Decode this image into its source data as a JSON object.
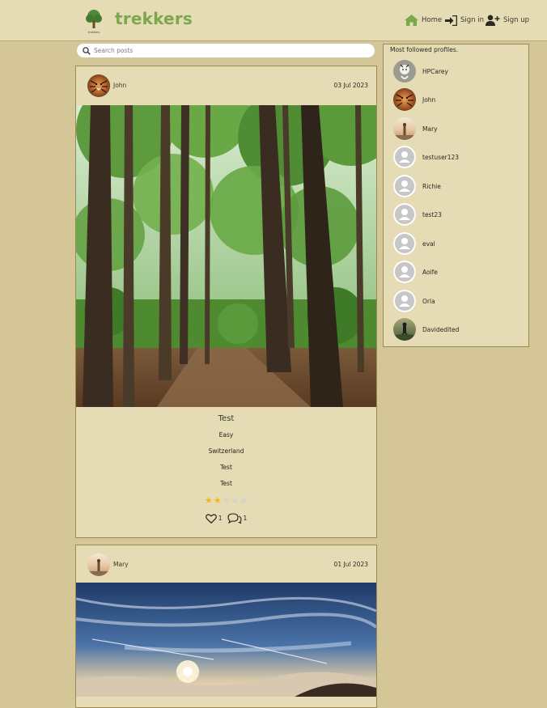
{
  "nav": {
    "brand": "trekkers",
    "logo_caption": "trekkers",
    "links": [
      {
        "label": "Home",
        "icon": "home-icon"
      },
      {
        "label": "Sign in",
        "icon": "sign-in-icon"
      },
      {
        "label": "Sign up",
        "icon": "add-user-icon"
      }
    ],
    "accent_color": "#7ba84a"
  },
  "search": {
    "placeholder": "Search posts",
    "value": ""
  },
  "posts": [
    {
      "author": "John",
      "date": "03 Jul 2023",
      "image": "forest-trail-photo",
      "title": "Test",
      "difficulty": "Easy",
      "location": "Switzerland",
      "line3": "Test",
      "line4": "Test",
      "rating": 2,
      "rating_max": 5,
      "likes": "1",
      "comments": "1"
    },
    {
      "author": "Mary",
      "date": "01 Jul 2023",
      "image": "sunset-above-clouds-photo"
    }
  ],
  "sidebar": {
    "title": "Most followed profiles.",
    "profiles": [
      {
        "name": "HPCarey",
        "avatar": "drawing"
      },
      {
        "name": "John",
        "avatar": "tiger"
      },
      {
        "name": "Mary",
        "avatar": "sunset"
      },
      {
        "name": "testuser123",
        "avatar": "default"
      },
      {
        "name": "Richie",
        "avatar": "default"
      },
      {
        "name": "test23",
        "avatar": "default"
      },
      {
        "name": "eval",
        "avatar": "default"
      },
      {
        "name": "Aoife",
        "avatar": "default"
      },
      {
        "name": "Orla",
        "avatar": "default"
      },
      {
        "name": "Davidedited",
        "avatar": "hiker"
      }
    ]
  }
}
